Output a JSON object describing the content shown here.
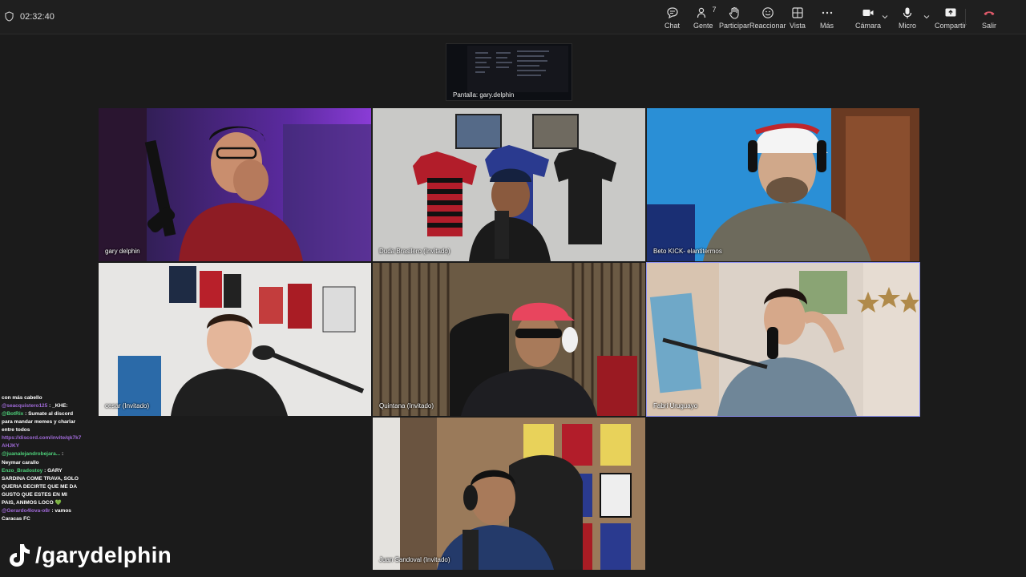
{
  "timer": "02:32:40",
  "toolbar": {
    "chat": "Chat",
    "people": "Gente",
    "people_count": "7",
    "participate": "Participar",
    "react": "Reaccionar",
    "view": "Vista",
    "more": "Más",
    "camera": "Cámara",
    "mic": "Micro",
    "share": "Compartir",
    "leave": "Salir"
  },
  "share_label": "Pantalla: gary.delphin",
  "participants": [
    {
      "name": "gary delphin"
    },
    {
      "name": "Duda Brasilero (Invitado)"
    },
    {
      "name": "Beto KICK- elantitermos"
    },
    {
      "name": "cesar (Invitado)"
    },
    {
      "name": "Quintana (Invitado)"
    },
    {
      "name": "Fabri Uruguayo"
    },
    {
      "name": "Juan Sandoval (Invitado)"
    }
  ],
  "colors": {
    "accent": "#8b8ff0",
    "leave": "#e05a6a",
    "chat_green": "#4ed17a",
    "chat_purple": "#a06ad8"
  },
  "chat": [
    {
      "user": "",
      "msg": "con más cabello"
    },
    {
      "user": "@seacquistero125",
      "msg": ": _KHE:"
    },
    {
      "user": "@BotRix",
      "msg": ": Sumate al discord para mandar memes y charlar entre todos"
    },
    {
      "user": "https://discord.com/invite/qk7k7AHJKY",
      "msg": ""
    },
    {
      "user": "@juanalejandrobejara...",
      "msg": ": Neymar carallo"
    },
    {
      "user": "Enzo_Bradostoy",
      "msg": ": GARY SARDINA COME TRAVA, SOLO QUERIA DECIRTE QUE ME DA GUSTO QUE ESTES EN MI PAIS, ANIMOS LOCO 💚"
    },
    {
      "user": "@Gerardo4lova-o8r",
      "msg": ": vamos Caracas FC"
    }
  ],
  "tiktok_handle": "/garydelphin"
}
